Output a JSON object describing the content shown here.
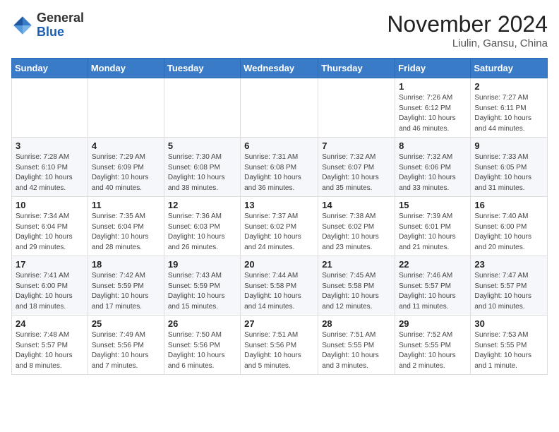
{
  "header": {
    "logo_general": "General",
    "logo_blue": "Blue",
    "month_year": "November 2024",
    "location": "Liulin, Gansu, China"
  },
  "weekdays": [
    "Sunday",
    "Monday",
    "Tuesday",
    "Wednesday",
    "Thursday",
    "Friday",
    "Saturday"
  ],
  "weeks": [
    [
      {
        "day": "",
        "info": ""
      },
      {
        "day": "",
        "info": ""
      },
      {
        "day": "",
        "info": ""
      },
      {
        "day": "",
        "info": ""
      },
      {
        "day": "",
        "info": ""
      },
      {
        "day": "1",
        "info": "Sunrise: 7:26 AM\nSunset: 6:12 PM\nDaylight: 10 hours\nand 46 minutes."
      },
      {
        "day": "2",
        "info": "Sunrise: 7:27 AM\nSunset: 6:11 PM\nDaylight: 10 hours\nand 44 minutes."
      }
    ],
    [
      {
        "day": "3",
        "info": "Sunrise: 7:28 AM\nSunset: 6:10 PM\nDaylight: 10 hours\nand 42 minutes."
      },
      {
        "day": "4",
        "info": "Sunrise: 7:29 AM\nSunset: 6:09 PM\nDaylight: 10 hours\nand 40 minutes."
      },
      {
        "day": "5",
        "info": "Sunrise: 7:30 AM\nSunset: 6:08 PM\nDaylight: 10 hours\nand 38 minutes."
      },
      {
        "day": "6",
        "info": "Sunrise: 7:31 AM\nSunset: 6:08 PM\nDaylight: 10 hours\nand 36 minutes."
      },
      {
        "day": "7",
        "info": "Sunrise: 7:32 AM\nSunset: 6:07 PM\nDaylight: 10 hours\nand 35 minutes."
      },
      {
        "day": "8",
        "info": "Sunrise: 7:32 AM\nSunset: 6:06 PM\nDaylight: 10 hours\nand 33 minutes."
      },
      {
        "day": "9",
        "info": "Sunrise: 7:33 AM\nSunset: 6:05 PM\nDaylight: 10 hours\nand 31 minutes."
      }
    ],
    [
      {
        "day": "10",
        "info": "Sunrise: 7:34 AM\nSunset: 6:04 PM\nDaylight: 10 hours\nand 29 minutes."
      },
      {
        "day": "11",
        "info": "Sunrise: 7:35 AM\nSunset: 6:04 PM\nDaylight: 10 hours\nand 28 minutes."
      },
      {
        "day": "12",
        "info": "Sunrise: 7:36 AM\nSunset: 6:03 PM\nDaylight: 10 hours\nand 26 minutes."
      },
      {
        "day": "13",
        "info": "Sunrise: 7:37 AM\nSunset: 6:02 PM\nDaylight: 10 hours\nand 24 minutes."
      },
      {
        "day": "14",
        "info": "Sunrise: 7:38 AM\nSunset: 6:02 PM\nDaylight: 10 hours\nand 23 minutes."
      },
      {
        "day": "15",
        "info": "Sunrise: 7:39 AM\nSunset: 6:01 PM\nDaylight: 10 hours\nand 21 minutes."
      },
      {
        "day": "16",
        "info": "Sunrise: 7:40 AM\nSunset: 6:00 PM\nDaylight: 10 hours\nand 20 minutes."
      }
    ],
    [
      {
        "day": "17",
        "info": "Sunrise: 7:41 AM\nSunset: 6:00 PM\nDaylight: 10 hours\nand 18 minutes."
      },
      {
        "day": "18",
        "info": "Sunrise: 7:42 AM\nSunset: 5:59 PM\nDaylight: 10 hours\nand 17 minutes."
      },
      {
        "day": "19",
        "info": "Sunrise: 7:43 AM\nSunset: 5:59 PM\nDaylight: 10 hours\nand 15 minutes."
      },
      {
        "day": "20",
        "info": "Sunrise: 7:44 AM\nSunset: 5:58 PM\nDaylight: 10 hours\nand 14 minutes."
      },
      {
        "day": "21",
        "info": "Sunrise: 7:45 AM\nSunset: 5:58 PM\nDaylight: 10 hours\nand 12 minutes."
      },
      {
        "day": "22",
        "info": "Sunrise: 7:46 AM\nSunset: 5:57 PM\nDaylight: 10 hours\nand 11 minutes."
      },
      {
        "day": "23",
        "info": "Sunrise: 7:47 AM\nSunset: 5:57 PM\nDaylight: 10 hours\nand 10 minutes."
      }
    ],
    [
      {
        "day": "24",
        "info": "Sunrise: 7:48 AM\nSunset: 5:57 PM\nDaylight: 10 hours\nand 8 minutes."
      },
      {
        "day": "25",
        "info": "Sunrise: 7:49 AM\nSunset: 5:56 PM\nDaylight: 10 hours\nand 7 minutes."
      },
      {
        "day": "26",
        "info": "Sunrise: 7:50 AM\nSunset: 5:56 PM\nDaylight: 10 hours\nand 6 minutes."
      },
      {
        "day": "27",
        "info": "Sunrise: 7:51 AM\nSunset: 5:56 PM\nDaylight: 10 hours\nand 5 minutes."
      },
      {
        "day": "28",
        "info": "Sunrise: 7:51 AM\nSunset: 5:55 PM\nDaylight: 10 hours\nand 3 minutes."
      },
      {
        "day": "29",
        "info": "Sunrise: 7:52 AM\nSunset: 5:55 PM\nDaylight: 10 hours\nand 2 minutes."
      },
      {
        "day": "30",
        "info": "Sunrise: 7:53 AM\nSunset: 5:55 PM\nDaylight: 10 hours\nand 1 minute."
      }
    ]
  ]
}
